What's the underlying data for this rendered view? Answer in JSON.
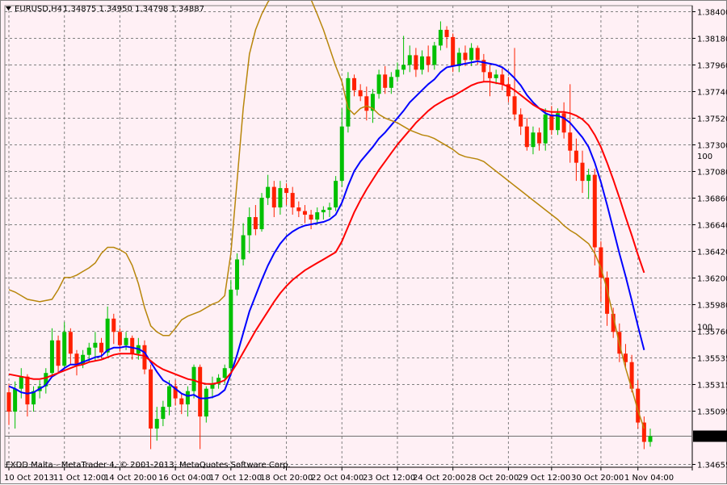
{
  "header": {
    "symbol_tf": "EURUSD,H4",
    "ohlc": "1.34875 1.34950 1.34798 1.34887"
  },
  "footer_copyright": "FXDD Malta - MetaTrader 4, © 2001-2013, MetaQuotes Software Corp.",
  "colors": {
    "background": "#fff0f5",
    "grid": "#808080",
    "bull": "#00c000",
    "bear": "#ff2000",
    "ma_fast": "#0000ff",
    "ma_slow": "#ff0000",
    "envelope": "#b8860b"
  },
  "chart_data": {
    "type": "line",
    "title": "",
    "price_ticks": [
      "1.38400",
      "1.38180",
      "1.37960",
      "1.37740",
      "1.37520",
      "1.37300",
      "1.37080",
      "1.36860",
      "1.36640",
      "1.36420",
      "1.36200",
      "1.35980",
      "1.35760",
      "1.35535",
      "1.35315",
      "1.35095",
      "1.34655"
    ],
    "price_tick_values": [
      1.384,
      1.3818,
      1.3796,
      1.3774,
      1.3752,
      1.373,
      1.3708,
      1.3686,
      1.3664,
      1.3642,
      1.362,
      1.3598,
      1.3576,
      1.35535,
      1.35315,
      1.35095,
      1.34655
    ],
    "ylim": [
      1.3463,
      1.3845
    ],
    "indicator_ticks": [
      {
        "label": "100",
        "value": 1.372
      },
      {
        "label": "100",
        "value": 1.3579
      }
    ],
    "current_price": "1.34887",
    "current_price_value": 1.34887,
    "x_labels": [
      "10 Oct 2013",
      "11 Oct 12:00",
      "14 Oct 20:00",
      "16 Oct 04:00",
      "17 Oct 12:00",
      "18 Oct 20:00",
      "22 Oct 04:00",
      "23 Oct 12:00",
      "24 Oct 20:00",
      "28 Oct 20:00",
      "29 Oct 12:00",
      "30 Oct 20:00",
      "1 Nov 04:00"
    ],
    "candles": [
      [
        1.3525,
        1.3532,
        1.3498,
        1.3509
      ],
      [
        1.3509,
        1.3534,
        1.3495,
        1.3528
      ],
      [
        1.3528,
        1.3545,
        1.352,
        1.3538
      ],
      [
        1.3538,
        1.354,
        1.3505,
        1.3515
      ],
      [
        1.3515,
        1.353,
        1.3509,
        1.3526
      ],
      [
        1.3526,
        1.3535,
        1.352,
        1.353
      ],
      [
        1.353,
        1.3545,
        1.3524,
        1.3541
      ],
      [
        1.3541,
        1.3578,
        1.3538,
        1.3568
      ],
      [
        1.3568,
        1.3572,
        1.3541,
        1.3547
      ],
      [
        1.3547,
        1.3583,
        1.3545,
        1.3575
      ],
      [
        1.3575,
        1.3578,
        1.3548,
        1.3557
      ],
      [
        1.3557,
        1.356,
        1.3539,
        1.3548
      ],
      [
        1.3548,
        1.356,
        1.3545,
        1.3556
      ],
      [
        1.3556,
        1.3566,
        1.355,
        1.3562
      ],
      [
        1.3562,
        1.3575,
        1.3551,
        1.3566
      ],
      [
        1.3566,
        1.357,
        1.3553,
        1.3558
      ],
      [
        1.3558,
        1.3596,
        1.3555,
        1.3586
      ],
      [
        1.3586,
        1.359,
        1.3565,
        1.3575
      ],
      [
        1.3575,
        1.3578,
        1.3559,
        1.3564
      ],
      [
        1.3564,
        1.3575,
        1.356,
        1.357
      ],
      [
        1.357,
        1.3572,
        1.3552,
        1.3557
      ],
      [
        1.3557,
        1.357,
        1.3552,
        1.3564
      ],
      [
        1.3564,
        1.3568,
        1.354,
        1.3544
      ],
      [
        1.3544,
        1.3548,
        1.3478,
        1.3495
      ],
      [
        1.3495,
        1.3513,
        1.3485,
        1.3503
      ],
      [
        1.3503,
        1.3518,
        1.3497,
        1.3513
      ],
      [
        1.3513,
        1.3535,
        1.3506,
        1.353
      ],
      [
        1.353,
        1.3535,
        1.3514,
        1.352
      ],
      [
        1.352,
        1.3524,
        1.3507,
        1.3515
      ],
      [
        1.3515,
        1.353,
        1.3505,
        1.3526
      ],
      [
        1.3526,
        1.3548,
        1.352,
        1.3546
      ],
      [
        1.3546,
        1.3548,
        1.3478,
        1.3505
      ],
      [
        1.3505,
        1.353,
        1.35,
        1.3528
      ],
      [
        1.3528,
        1.3538,
        1.352,
        1.3532
      ],
      [
        1.3532,
        1.354,
        1.3528,
        1.3537
      ],
      [
        1.3537,
        1.3548,
        1.3532,
        1.3545
      ],
      [
        1.3545,
        1.3618,
        1.354,
        1.361
      ],
      [
        1.361,
        1.364,
        1.3605,
        1.3635
      ],
      [
        1.3635,
        1.3665,
        1.363,
        1.3655
      ],
      [
        1.3655,
        1.3678,
        1.364,
        1.367
      ],
      [
        1.367,
        1.368,
        1.3655,
        1.366
      ],
      [
        1.366,
        1.369,
        1.3658,
        1.3686
      ],
      [
        1.3686,
        1.3705,
        1.368,
        1.3695
      ],
      [
        1.3695,
        1.37,
        1.367,
        1.3678
      ],
      [
        1.3678,
        1.37,
        1.3672,
        1.3694
      ],
      [
        1.3694,
        1.3698,
        1.368,
        1.369
      ],
      [
        1.369,
        1.3695,
        1.3672,
        1.3678
      ],
      [
        1.3678,
        1.3683,
        1.367,
        1.3675
      ],
      [
        1.3675,
        1.368,
        1.3665,
        1.3672
      ],
      [
        1.3672,
        1.3676,
        1.366,
        1.3668
      ],
      [
        1.3668,
        1.3678,
        1.3664,
        1.3674
      ],
      [
        1.3674,
        1.3679,
        1.3668,
        1.3676
      ],
      [
        1.3676,
        1.3682,
        1.367,
        1.3678
      ],
      [
        1.3678,
        1.3704,
        1.3675,
        1.37
      ],
      [
        1.37,
        1.376,
        1.3695,
        1.3745
      ],
      [
        1.3745,
        1.379,
        1.374,
        1.3785
      ],
      [
        1.3785,
        1.3788,
        1.377,
        1.3775
      ],
      [
        1.3775,
        1.378,
        1.3766,
        1.377
      ],
      [
        1.377,
        1.3778,
        1.375,
        1.3758
      ],
      [
        1.3758,
        1.3776,
        1.3748,
        1.3772
      ],
      [
        1.3772,
        1.3792,
        1.3768,
        1.3788
      ],
      [
        1.3788,
        1.3795,
        1.3772,
        1.3777
      ],
      [
        1.3777,
        1.379,
        1.3772,
        1.3786
      ],
      [
        1.3786,
        1.3798,
        1.3782,
        1.3792
      ],
      [
        1.3792,
        1.382,
        1.3788,
        1.3796
      ],
      [
        1.3796,
        1.3812,
        1.379,
        1.3804
      ],
      [
        1.3804,
        1.381,
        1.3786,
        1.3792
      ],
      [
        1.3792,
        1.3808,
        1.3788,
        1.3803
      ],
      [
        1.3803,
        1.3812,
        1.379,
        1.3796
      ],
      [
        1.3796,
        1.3815,
        1.3792,
        1.3812
      ],
      [
        1.3812,
        1.3832,
        1.3808,
        1.3825
      ],
      [
        1.3825,
        1.3828,
        1.381,
        1.3819
      ],
      [
        1.3819,
        1.3822,
        1.379,
        1.3795
      ],
      [
        1.3795,
        1.381,
        1.379,
        1.3806
      ],
      [
        1.3806,
        1.3812,
        1.3795,
        1.38
      ],
      [
        1.38,
        1.3814,
        1.3795,
        1.381
      ],
      [
        1.381,
        1.3812,
        1.3796,
        1.38
      ],
      [
        1.38,
        1.3805,
        1.3782,
        1.379
      ],
      [
        1.379,
        1.3796,
        1.377,
        1.3785
      ],
      [
        1.3785,
        1.3792,
        1.378,
        1.3788
      ],
      [
        1.3788,
        1.3794,
        1.3775,
        1.378
      ],
      [
        1.378,
        1.3786,
        1.3765,
        1.377
      ],
      [
        1.377,
        1.381,
        1.375,
        1.3755
      ],
      [
        1.3755,
        1.376,
        1.3738,
        1.3745
      ],
      [
        1.3745,
        1.3752,
        1.3725,
        1.3728
      ],
      [
        1.3728,
        1.3745,
        1.3722,
        1.374
      ],
      [
        1.374,
        1.3744,
        1.3725,
        1.3731
      ],
      [
        1.3731,
        1.376,
        1.3725,
        1.3755
      ],
      [
        1.3755,
        1.3762,
        1.3738,
        1.3742
      ],
      [
        1.3742,
        1.376,
        1.3738,
        1.3756
      ],
      [
        1.3756,
        1.3765,
        1.3735,
        1.374
      ],
      [
        1.374,
        1.378,
        1.3715,
        1.3725
      ],
      [
        1.3725,
        1.3735,
        1.37,
        1.3715
      ],
      [
        1.3715,
        1.3725,
        1.369,
        1.37
      ],
      [
        1.37,
        1.371,
        1.3685,
        1.3705
      ],
      [
        1.3705,
        1.371,
        1.363,
        1.3645
      ],
      [
        1.3645,
        1.365,
        1.36,
        1.362
      ],
      [
        1.362,
        1.3625,
        1.358,
        1.359
      ],
      [
        1.359,
        1.3595,
        1.357,
        1.3575
      ],
      [
        1.3575,
        1.3582,
        1.355,
        1.3557
      ],
      [
        1.3557,
        1.3565,
        1.3545,
        1.355
      ],
      [
        1.355,
        1.3556,
        1.3525,
        1.3528
      ],
      [
        1.3528,
        1.3535,
        1.3495,
        1.35
      ],
      [
        1.35,
        1.3505,
        1.3478,
        1.3484
      ],
      [
        1.3484,
        1.3495,
        1.348,
        1.34887
      ]
    ],
    "series": [
      {
        "name": "",
        "color": "#0000ff",
        "values": [
          1.353,
          1.3528,
          1.3525,
          1.3524,
          1.3525,
          1.3528,
          1.3531,
          1.3538,
          1.3541,
          1.3545,
          1.3548,
          1.3548,
          1.355,
          1.3552,
          1.3554,
          1.3555,
          1.356,
          1.3562,
          1.3562,
          1.3563,
          1.3562,
          1.3561,
          1.3558,
          1.355,
          1.3542,
          1.3535,
          1.3532,
          1.3528,
          1.3524,
          1.3522,
          1.3523,
          1.352,
          1.352,
          1.3521,
          1.3523,
          1.3527,
          1.354,
          1.3556,
          1.3574,
          1.3592,
          1.3605,
          1.3618,
          1.363,
          1.364,
          1.3648,
          1.3654,
          1.3658,
          1.3661,
          1.3663,
          1.3664,
          1.3665,
          1.3666,
          1.3668,
          1.3672,
          1.3682,
          1.3696,
          1.3708,
          1.3716,
          1.3722,
          1.3728,
          1.3735,
          1.374,
          1.3746,
          1.3752,
          1.3758,
          1.3765,
          1.377,
          1.3775,
          1.378,
          1.3784,
          1.379,
          1.3794,
          1.3795,
          1.3796,
          1.3797,
          1.3798,
          1.3799,
          1.3798,
          1.3797,
          1.3796,
          1.3794,
          1.379,
          1.3785,
          1.3779,
          1.3771,
          1.3765,
          1.376,
          1.3756,
          1.3754,
          1.3754,
          1.3752,
          1.3748,
          1.3742,
          1.3736,
          1.3728,
          1.3715,
          1.3699,
          1.368,
          1.366,
          1.364,
          1.3621,
          1.3601,
          1.358,
          1.356
        ]
      },
      {
        "name": "",
        "color": "#ff0000",
        "values": [
          1.354,
          1.3539,
          1.3538,
          1.3537,
          1.3536,
          1.3536,
          1.3537,
          1.3539,
          1.3541,
          1.3543,
          1.3545,
          1.3547,
          1.3548,
          1.355,
          1.3551,
          1.3552,
          1.3554,
          1.3556,
          1.3557,
          1.3557,
          1.3557,
          1.3556,
          1.3555,
          1.3551,
          1.3547,
          1.3544,
          1.3542,
          1.354,
          1.3538,
          1.3536,
          1.3535,
          1.3533,
          1.3532,
          1.3532,
          1.3533,
          1.3535,
          1.3541,
          1.3549,
          1.3558,
          1.3567,
          1.3576,
          1.3584,
          1.3592,
          1.36,
          1.3607,
          1.3613,
          1.3618,
          1.3622,
          1.3626,
          1.3629,
          1.3632,
          1.3635,
          1.3638,
          1.3641,
          1.365,
          1.3662,
          1.3674,
          1.3684,
          1.3693,
          1.3701,
          1.3709,
          1.3716,
          1.3723,
          1.373,
          1.3736,
          1.3742,
          1.3748,
          1.3753,
          1.3758,
          1.3762,
          1.3765,
          1.3768,
          1.377,
          1.3773,
          1.3776,
          1.3779,
          1.3781,
          1.3782,
          1.3782,
          1.3781,
          1.378,
          1.3778,
          1.3775,
          1.3771,
          1.3767,
          1.3763,
          1.376,
          1.3758,
          1.3757,
          1.3757,
          1.3757,
          1.3756,
          1.3754,
          1.3751,
          1.3746,
          1.3738,
          1.3728,
          1.3715,
          1.3701,
          1.3686,
          1.367,
          1.3655,
          1.3639,
          1.3624
        ]
      },
      {
        "name": "",
        "color": "#b8860b",
        "values": [
          1.361,
          1.3608,
          1.3605,
          1.3602,
          1.3601,
          1.36,
          1.3601,
          1.3602,
          1.361,
          1.362,
          1.362,
          1.3622,
          1.3625,
          1.3628,
          1.3632,
          1.364,
          1.3645,
          1.3645,
          1.3643,
          1.364,
          1.363,
          1.3615,
          1.3595,
          1.358,
          1.3575,
          1.3572,
          1.3572,
          1.3578,
          1.3585,
          1.3588,
          1.359,
          1.3592,
          1.3595,
          1.3598,
          1.36,
          1.3605,
          1.364,
          1.37,
          1.376,
          1.3805,
          1.3825,
          1.3838,
          1.3848,
          1.3855,
          1.386,
          1.3865,
          1.3868,
          1.3866,
          1.386,
          1.385,
          1.3838,
          1.3825,
          1.381,
          1.3795,
          1.3782,
          1.376,
          1.3755,
          1.376,
          1.3762,
          1.376,
          1.3755,
          1.3752,
          1.375,
          1.3748,
          1.3745,
          1.3742,
          1.374,
          1.3738,
          1.3737,
          1.3735,
          1.3732,
          1.3729,
          1.3726,
          1.3722,
          1.372,
          1.3719,
          1.3718,
          1.3716,
          1.3712,
          1.3708,
          1.3704,
          1.37,
          1.3696,
          1.3692,
          1.3688,
          1.3684,
          1.368,
          1.3676,
          1.3672,
          1.3668,
          1.3663,
          1.3659,
          1.3656,
          1.3652,
          1.3648,
          1.364,
          1.3628,
          1.361,
          1.3588,
          1.3565,
          1.3545,
          1.3528,
          1.351,
          1.3495
        ]
      }
    ]
  }
}
